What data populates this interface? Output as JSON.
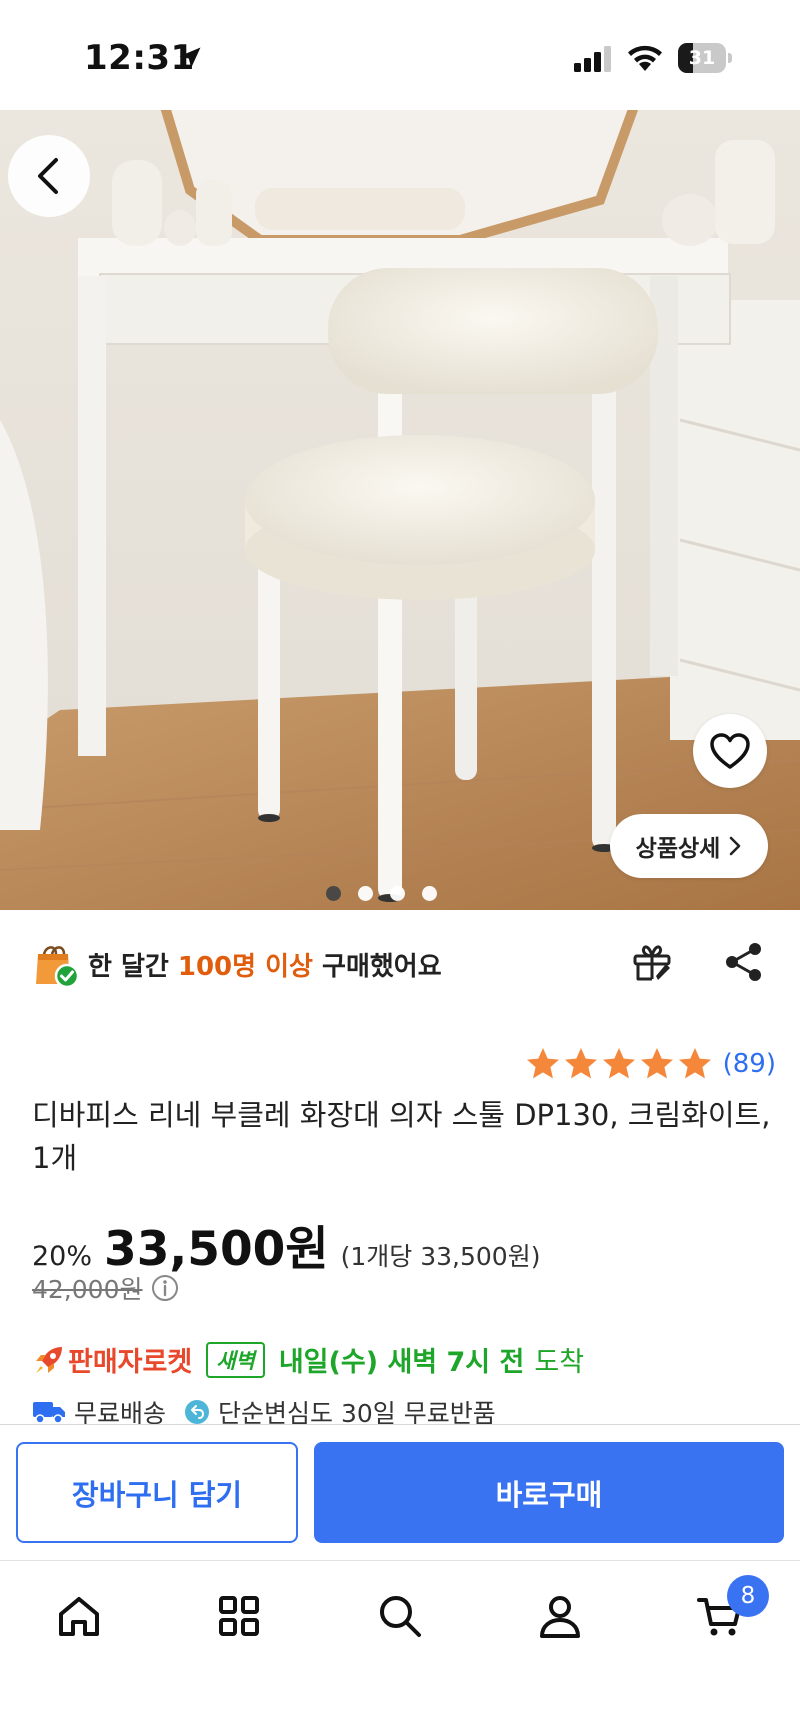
{
  "status_bar": {
    "time": "12:31",
    "battery_level": "31"
  },
  "gallery": {
    "detail_button_label": "상품상세",
    "image_count": 4,
    "active_index": 0
  },
  "purchase_banner": {
    "prefix": "한 달간 ",
    "highlight": "100명 이상",
    "suffix": " 구매했어요"
  },
  "rating": {
    "stars": 5,
    "count": "(89)"
  },
  "product": {
    "title": "디바피스 리네 부클레 화장대 의자 스툴 DP130, 크림화이트, 1개"
  },
  "price": {
    "discount": "20%",
    "sale_price": "33,500원",
    "unit_price": "(1개당 33,500원)",
    "original_price": "42,000원"
  },
  "delivery": {
    "rocket_label": "판매자로켓",
    "badge": "새벽",
    "arrival_bold": "내일(수) 새벽 7시 전",
    "arrival_suffix": "도착",
    "free_shipping": "무료배송",
    "returns": "단순변심도 30일 무료반품"
  },
  "actions": {
    "add_to_cart": "장바구니 담기",
    "buy_now": "바로구매"
  },
  "tab_bar": {
    "cart_count": "8"
  },
  "colors": {
    "accent": "#3a73f2",
    "link_blue": "#2d6ff0",
    "highlight_orange": "#e05d0e",
    "rocket_red": "#e8482b",
    "delivery_green": "#1ea62a",
    "star_orange": "#f5873a"
  }
}
